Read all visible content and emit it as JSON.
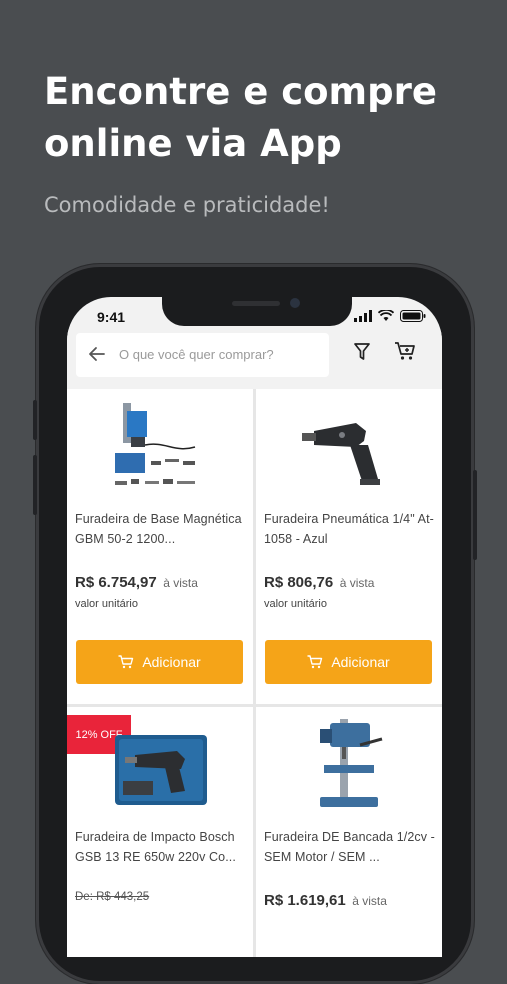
{
  "promo": {
    "headline": "Encontre e compre online via App",
    "subheadline": "Comodidade e praticidade!"
  },
  "status_bar": {
    "time": "9:41"
  },
  "search": {
    "placeholder": "O que você quer comprar?"
  },
  "icons": {
    "back": "arrow-left-icon",
    "filter": "filter-icon",
    "cart": "cart-icon"
  },
  "colors": {
    "accent": "#f5a418",
    "badge": "#e9243a",
    "background": "#4a4d50"
  },
  "products": [
    {
      "name": "Furadeira de Base Magnética GBM 50-2 1200...",
      "price": "R$ 6.754,97",
      "price_suffix": "à vista",
      "unit_label": "valor unitário",
      "add_label": "Adicionar"
    },
    {
      "name": "Furadeira Pneumática  1/4\" At-1058 - Azul",
      "price": "R$ 806,76",
      "price_suffix": "à vista",
      "unit_label": "valor unitário",
      "add_label": "Adicionar"
    },
    {
      "badge": "12% OFF",
      "name": "Furadeira de Impacto Bosch GSB 13 RE 650w 220v Co...",
      "old_price": "De: R$ 443,25"
    },
    {
      "name": "Furadeira DE Bancada 1/2cv - SEM Motor / SEM ...",
      "price": "R$ 1.619,61",
      "price_suffix": "à vista"
    }
  ]
}
